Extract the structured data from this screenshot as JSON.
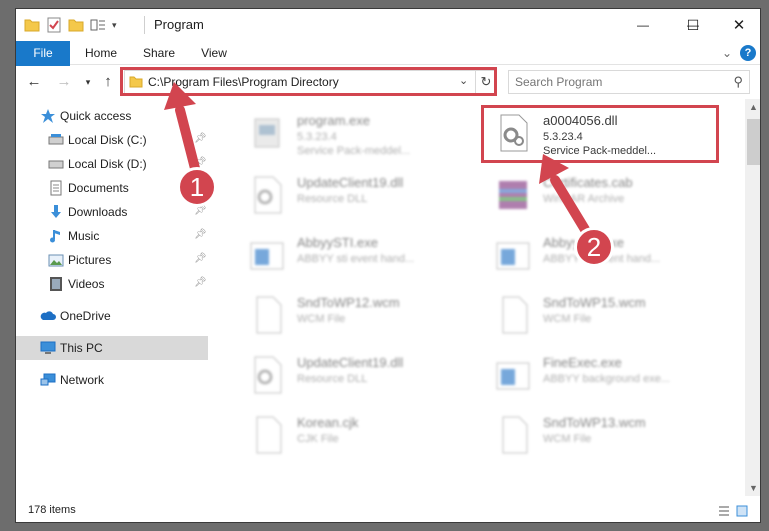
{
  "window": {
    "title": "Program",
    "minimize": "—",
    "maximize": "☐",
    "close": "✕"
  },
  "ribbon": {
    "tabs": [
      {
        "label": "File"
      },
      {
        "label": "Home"
      },
      {
        "label": "Share"
      },
      {
        "label": "View"
      }
    ],
    "help": "?"
  },
  "nav": {
    "address": "C:\\Program Files\\Program Directory",
    "search_placeholder": "Search Program"
  },
  "sidebar": {
    "items": [
      {
        "label": "Quick access"
      },
      {
        "label": "Local Disk (C:)"
      },
      {
        "label": "Local Disk (D:)"
      },
      {
        "label": "Documents"
      },
      {
        "label": "Downloads"
      },
      {
        "label": "Music"
      },
      {
        "label": "Pictures"
      },
      {
        "label": "Videos"
      },
      {
        "label": "OneDrive"
      },
      {
        "label": "This PC"
      },
      {
        "label": "Network"
      }
    ]
  },
  "files": [
    {
      "name": "program.exe",
      "line2": "5.3.23.4",
      "line3": "Service Pack-meddel...",
      "icon": "exe-icon"
    },
    {
      "name": "a0004056.dll",
      "line2": "5.3.23.4",
      "line3": "Service Pack-meddel...",
      "icon": "dll-gear-icon"
    },
    {
      "name": "UpdateClient19.dll",
      "line2": "Resource DLL",
      "line3": "",
      "icon": "dll-gear-icon"
    },
    {
      "name": "Certificates.cab",
      "line2": "WinRAR Archive",
      "line3": "",
      "icon": "winrar-icon"
    },
    {
      "name": "AbbyySTI.exe",
      "line2": "ABBYY sti event hand...",
      "line3": "",
      "icon": "app-window-icon"
    },
    {
      "name": "AbbyySTI.exe",
      "line2": "ABBYY sti event hand...",
      "line3": "",
      "icon": "app-window-icon"
    },
    {
      "name": "SndToWP12.wcm",
      "line2": "WCM File",
      "line3": "",
      "icon": "blank-file-icon"
    },
    {
      "name": "SndToWP15.wcm",
      "line2": "WCM File",
      "line3": "",
      "icon": "blank-file-icon"
    },
    {
      "name": "UpdateClient19.dll",
      "line2": "Resource DLL",
      "line3": "",
      "icon": "dll-gear-icon"
    },
    {
      "name": "FineExec.exe",
      "line2": "ABBYY background exe...",
      "line3": "",
      "icon": "app-window-icon"
    },
    {
      "name": "Korean.cjk",
      "line2": "CJK File",
      "line3": "",
      "icon": "blank-file-icon"
    },
    {
      "name": "SndToWP13.wcm",
      "line2": "WCM File",
      "line3": "",
      "icon": "blank-file-icon"
    }
  ],
  "status": {
    "count": "178 items"
  },
  "annotations": {
    "badge1": "1",
    "badge2": "2",
    "color": "#d2454f"
  }
}
